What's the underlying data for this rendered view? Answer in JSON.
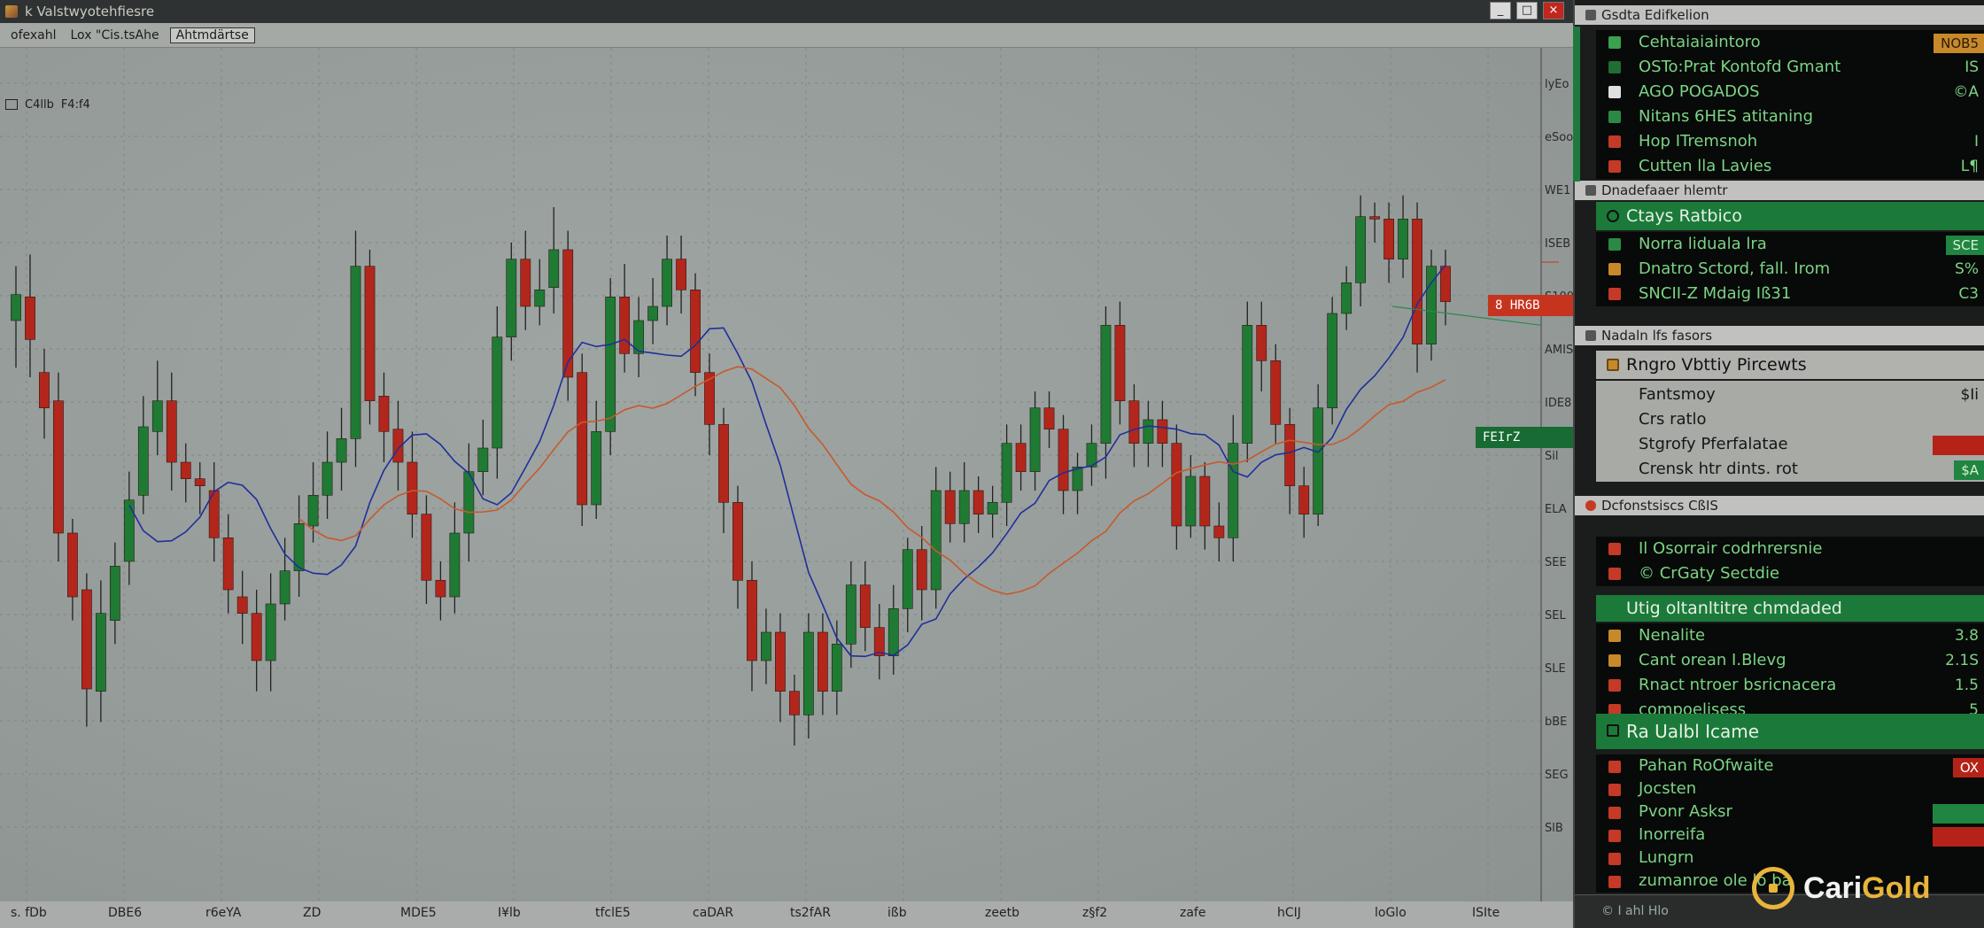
{
  "titlebar": {
    "text": "k  Valstwyotehfiesre"
  },
  "toolbar": {
    "items": [
      "ofexahl",
      "Lox  \"Cis.tsAhe",
      "Ahtmdärtse"
    ]
  },
  "subtoolbar": {
    "items": [
      "C4llb",
      "F4:f4"
    ]
  },
  "price_tags": {
    "red": "8 HR6B",
    "green": "FEIrZ"
  },
  "x_axis_labels": [
    "s. fDb",
    "DBE6",
    "r6eYA",
    "ZD",
    "MDE5",
    "I¥lb",
    "tfclE5",
    "caDAR",
    "ts2fAR",
    "ißb",
    "zeetb",
    "z§f2",
    "zafe",
    "hCIJ",
    "loGlo",
    "ISIte"
  ],
  "right_panel": {
    "header1": "Gsdta Edifkelion",
    "block1": [
      {
        "label": "Cehtaiaiaintoro",
        "value": "NOB5",
        "kind": "amber",
        "icon_color": "#3aa14f"
      },
      {
        "label": "OSTo:Prat Kontofd Gmant",
        "value": "IS",
        "kind": "text",
        "icon_color": "#1f6e35"
      },
      {
        "label": "AGO POGADOS",
        "value": "©A",
        "kind": "text",
        "icon_color": "#e0e0e0"
      },
      {
        "label": "Nitans 6HES atitaning",
        "value": "",
        "kind": "text",
        "icon_color": "#2a8a45"
      },
      {
        "label": "Hop  ITremsnoh",
        "value": "I",
        "kind": "text",
        "icon_color": "#c43a26"
      },
      {
        "label": "Cutten  lla Lavies",
        "value": "L¶",
        "kind": "text",
        "icon_color": "#c43a26"
      }
    ],
    "header2": "Dnadefaaer hlemtr",
    "title2": "Ctays Ratbico",
    "block2": [
      {
        "label": "Norra liduala lra",
        "value": "SCE",
        "kind": "green",
        "icon_color": "#2a8a45"
      },
      {
        "label": "Dnatro Sctord, fall. Irom",
        "value": "S%",
        "kind": "text",
        "icon_color": "#c7892a"
      },
      {
        "label": "SNCII-Z  Mdaig  Iß31",
        "value": "C3",
        "kind": "text",
        "icon_color": "#c43a26"
      }
    ],
    "header3": "Nadaln lfs fasors",
    "title3": "Rngro Vbttiy Pircewts",
    "block3": [
      {
        "label": "Fantsmoy",
        "value": "$Ii",
        "kind": "text"
      },
      {
        "label": "Crs ratlo",
        "value": "",
        "kind": "text"
      },
      {
        "label": "Stgrofy Pferfalatae",
        "value": "",
        "kind": "red"
      },
      {
        "label": "Crensk  htr dints. rot",
        "value": "$A",
        "kind": "green"
      }
    ],
    "header4": "Dcfonstsiscs  CßIS",
    "block4": [
      {
        "label": "Il Osorrair codrhrersnie",
        "value": "",
        "kind": "text",
        "icon_color": "#c43a26"
      },
      {
        "label": "© CrGaty Sectdie",
        "value": "",
        "kind": "text",
        "icon_color": "#c43a26"
      }
    ],
    "title5": "Utig  oltanltitre  chmdaded",
    "block5": [
      {
        "label": "Nenalite",
        "value": "3.8",
        "kind": "text",
        "icon_color": "#c7892a"
      },
      {
        "label": "Cant orean  I.Blevg",
        "value": "2.1S",
        "kind": "text",
        "icon_color": "#c7892a"
      },
      {
        "label": "Rnact  ntroer  bsricnacera",
        "value": "1.5",
        "kind": "text",
        "icon_color": "#c43a26"
      },
      {
        "label": "compoelisess",
        "value": "5",
        "kind": "text",
        "icon_color": "#c43a26"
      }
    ],
    "title6": "Ra Ualbl  Icame",
    "block6": [
      {
        "label": "Pahan RoOfwaite",
        "value": "OX",
        "kind": "red",
        "icon_color": "#c43a26"
      },
      {
        "label": "Jocsten",
        "value": "",
        "kind": "text",
        "icon_color": "#c43a26"
      },
      {
        "label": "Pvonr Asksr",
        "value": "",
        "kind": "green",
        "icon_color": "#c43a26"
      },
      {
        "label": "Inorreifa",
        "value": "",
        "kind": "red",
        "icon_color": "#c43a26"
      },
      {
        "label": "Lungrn",
        "value": "",
        "kind": "text",
        "icon_color": "#c43a26"
      },
      {
        "label": "zumanroe  ole  lo  ba",
        "value": "",
        "kind": "text",
        "icon_color": "#c43a26"
      }
    ],
    "bottom": "© I  ahl  Hlo"
  },
  "watermark": {
    "part1": "Cari",
    "part2": "Gold"
  },
  "chart_data": {
    "type": "candlestick",
    "y_ticks": [
      "lyEo",
      "eSoo",
      "WE1",
      "ISEB",
      "S100",
      "AMIS",
      "IDE8",
      "Sil",
      "ELA",
      "SEE",
      "SEL",
      "SLE",
      "bBE",
      "SEG",
      "SlB"
    ],
    "candles": [
      [
        522,
        533,
        502,
        545
      ],
      [
        532,
        514,
        498,
        550
      ],
      [
        500,
        485,
        472,
        510
      ],
      [
        488,
        432,
        420,
        500
      ],
      [
        432,
        405,
        395,
        438
      ],
      [
        408,
        366,
        350,
        415
      ],
      [
        365,
        398,
        352,
        412
      ],
      [
        395,
        418,
        385,
        428
      ],
      [
        420,
        446,
        410,
        458
      ],
      [
        448,
        477,
        440,
        490
      ],
      [
        475,
        488,
        465,
        505
      ],
      [
        488,
        462,
        450,
        500
      ],
      [
        462,
        455,
        445,
        470
      ],
      [
        455,
        452,
        440,
        462
      ],
      [
        450,
        430,
        420,
        462
      ],
      [
        430,
        408,
        398,
        440
      ],
      [
        405,
        398,
        385,
        416
      ],
      [
        398,
        378,
        365,
        408
      ],
      [
        378,
        402,
        365,
        415
      ],
      [
        402,
        416,
        395,
        430
      ],
      [
        416,
        436,
        405,
        448
      ],
      [
        435,
        448,
        428,
        462
      ],
      [
        448,
        462,
        438,
        475
      ],
      [
        462,
        472,
        450,
        485
      ],
      [
        472,
        545,
        460,
        560
      ],
      [
        545,
        488,
        478,
        552
      ],
      [
        490,
        475,
        462,
        500
      ],
      [
        476,
        462,
        450,
        488
      ],
      [
        462,
        440,
        430,
        475
      ],
      [
        440,
        412,
        402,
        448
      ],
      [
        412,
        405,
        395,
        420
      ],
      [
        405,
        432,
        398,
        445
      ],
      [
        432,
        458,
        420,
        470
      ],
      [
        458,
        468,
        448,
        480
      ],
      [
        468,
        515,
        455,
        528
      ],
      [
        515,
        548,
        505,
        555
      ],
      [
        548,
        528,
        518,
        560
      ],
      [
        528,
        535,
        520,
        548
      ],
      [
        536,
        552,
        525,
        570
      ],
      [
        552,
        498,
        488,
        560
      ],
      [
        500,
        444,
        435,
        508
      ],
      [
        444,
        475,
        438,
        488
      ],
      [
        475,
        532,
        465,
        540
      ],
      [
        532,
        508,
        500,
        546
      ],
      [
        508,
        522,
        498,
        532
      ],
      [
        522,
        528,
        512,
        540
      ],
      [
        528,
        548,
        520,
        558
      ],
      [
        548,
        535,
        525,
        558
      ],
      [
        535,
        500,
        490,
        542
      ],
      [
        500,
        478,
        465,
        508
      ],
      [
        478,
        445,
        432,
        485
      ],
      [
        445,
        412,
        400,
        452
      ],
      [
        412,
        378,
        365,
        420
      ],
      [
        378,
        390,
        368,
        400
      ],
      [
        390,
        365,
        352,
        398
      ],
      [
        365,
        355,
        342,
        372
      ],
      [
        355,
        390,
        345,
        398
      ],
      [
        390,
        365,
        355,
        398
      ],
      [
        365,
        385,
        355,
        395
      ],
      [
        385,
        410,
        375,
        420
      ],
      [
        410,
        392,
        382,
        420
      ],
      [
        392,
        380,
        370,
        402
      ],
      [
        380,
        400,
        372,
        410
      ],
      [
        400,
        425,
        390,
        430
      ],
      [
        425,
        408,
        395,
        435
      ],
      [
        408,
        450,
        400,
        460
      ],
      [
        450,
        436,
        428,
        458
      ],
      [
        436,
        450,
        428,
        462
      ],
      [
        450,
        440,
        432,
        456
      ],
      [
        440,
        445,
        430,
        452
      ],
      [
        445,
        470,
        435,
        478
      ],
      [
        470,
        458,
        450,
        478
      ],
      [
        458,
        485,
        450,
        492
      ],
      [
        485,
        476,
        468,
        492
      ],
      [
        476,
        450,
        440,
        482
      ],
      [
        450,
        460,
        440,
        466
      ],
      [
        460,
        470,
        452,
        478
      ],
      [
        470,
        520,
        455,
        528
      ],
      [
        520,
        488,
        478,
        530
      ],
      [
        488,
        470,
        460,
        495
      ],
      [
        470,
        480,
        460,
        488
      ],
      [
        480,
        470,
        460,
        488
      ],
      [
        470,
        435,
        425,
        478
      ],
      [
        435,
        456,
        430,
        465
      ],
      [
        456,
        435,
        425,
        462
      ],
      [
        435,
        430,
        420,
        445
      ],
      [
        430,
        470,
        420,
        482
      ],
      [
        470,
        520,
        462,
        530
      ],
      [
        520,
        505,
        492,
        530
      ],
      [
        505,
        478,
        470,
        512
      ],
      [
        478,
        452,
        440,
        485
      ],
      [
        452,
        440,
        430,
        460
      ],
      [
        440,
        485,
        435,
        495
      ],
      [
        485,
        525,
        478,
        532
      ],
      [
        525,
        538,
        518,
        545
      ],
      [
        538,
        566,
        528,
        575
      ],
      [
        566,
        565,
        555,
        572
      ],
      [
        565,
        548,
        538,
        572
      ],
      [
        548,
        565,
        540,
        575
      ],
      [
        565,
        512,
        500,
        572
      ],
      [
        512,
        545,
        505,
        552
      ],
      [
        545,
        530,
        520,
        552
      ]
    ]
  }
}
